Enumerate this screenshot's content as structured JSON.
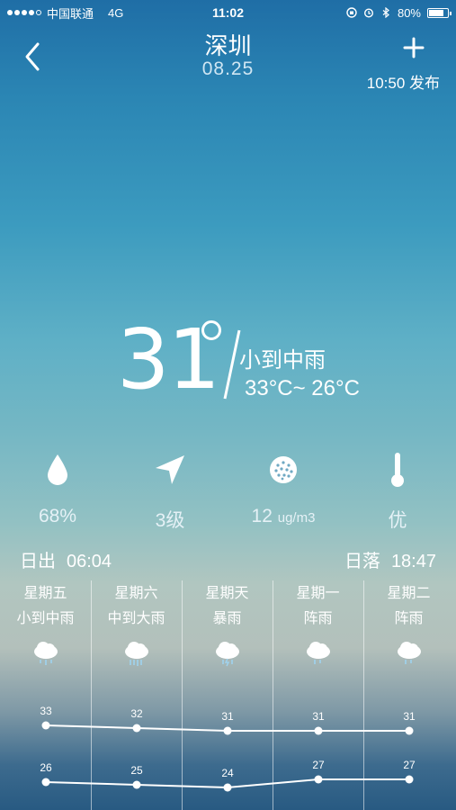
{
  "status": {
    "carrier": "中国联通",
    "network": "4G",
    "time": "11:02",
    "battery": "80%",
    "battery_level": 0.8
  },
  "header": {
    "city": "深圳",
    "date": "08.25",
    "publish": "10:50 发布"
  },
  "current": {
    "temp": "31",
    "desc": "小到中雨",
    "range": "33°C~ 26°C"
  },
  "metrics": [
    {
      "icon": "humidity-drop-icon",
      "value": "68%",
      "unit": ""
    },
    {
      "icon": "wind-arrow-icon",
      "value": "3级",
      "unit": ""
    },
    {
      "icon": "pm25-icon",
      "value": "12",
      "unit": "ug/m3"
    },
    {
      "icon": "thermometer-icon",
      "value": "优",
      "unit": ""
    }
  ],
  "sun": {
    "sunrise_label": "日出",
    "sunrise": "06:04",
    "sunset_label": "日落",
    "sunset": "18:47"
  },
  "forecast": [
    {
      "day": "星期五",
      "weather": "小到中雨",
      "icon": "rain-cloud-icon",
      "high": 33,
      "low": 26
    },
    {
      "day": "星期六",
      "weather": "中到大雨",
      "icon": "heavy-rain-cloud-icon",
      "high": 32,
      "low": 25
    },
    {
      "day": "星期天",
      "weather": "暴雨",
      "icon": "storm-cloud-icon",
      "high": 31,
      "low": 24
    },
    {
      "day": "星期一",
      "weather": "阵雨",
      "icon": "shower-cloud-icon",
      "high": 31,
      "low": 27
    },
    {
      "day": "星期二",
      "weather": "阵雨",
      "icon": "shower-cloud-icon",
      "high": 31,
      "low": 27
    }
  ],
  "chart_data": {
    "type": "line",
    "categories": [
      "星期五",
      "星期六",
      "星期天",
      "星期一",
      "星期二"
    ],
    "series": [
      {
        "values": [
          33,
          32,
          31,
          31,
          31
        ]
      },
      {
        "values": [
          26,
          25,
          24,
          27,
          27
        ]
      }
    ]
  }
}
